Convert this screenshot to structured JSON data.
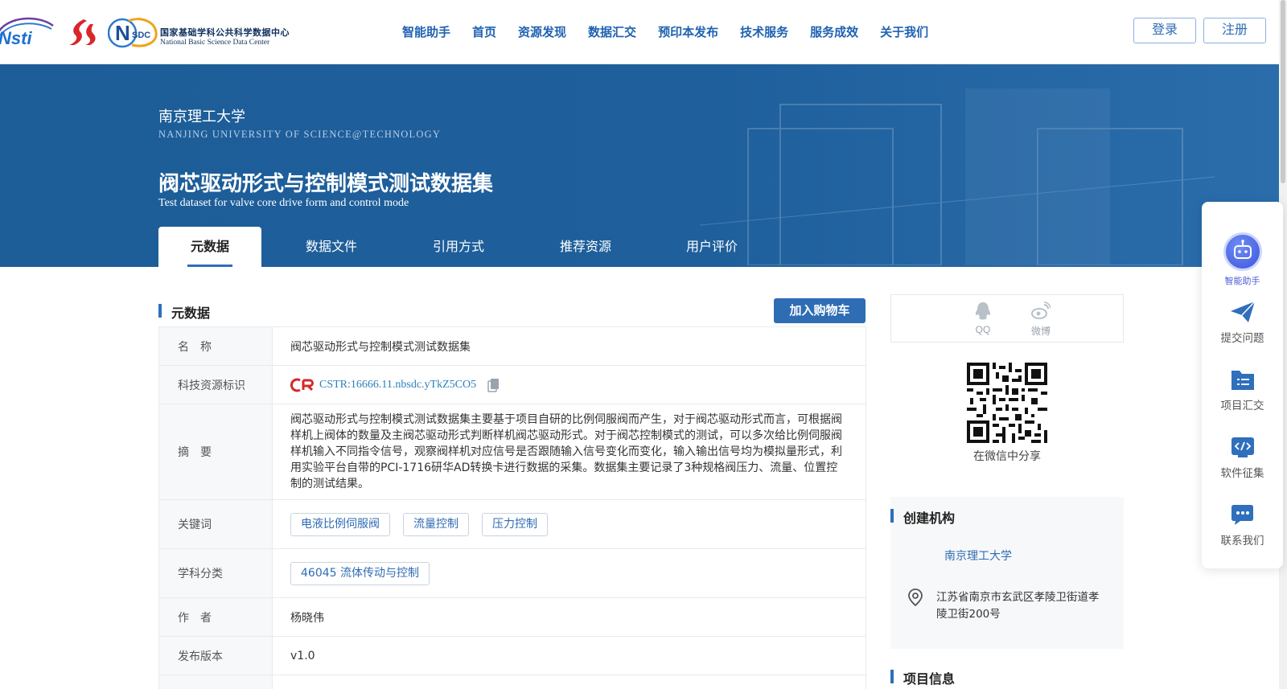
{
  "header": {
    "logo_nsti_text": "Nsti",
    "logo_nsdc_cn": "国家基础学科公共科学数据中心",
    "logo_nsdc_en": "National Basic Science Data Center",
    "logo_nsdc_badge": "SDC",
    "nav": [
      "智能助手",
      "首页",
      "资源发现",
      "数据汇交",
      "预印本发布",
      "技术服务",
      "服务成效",
      "关于我们"
    ],
    "login_label": "登录",
    "register_label": "注册"
  },
  "banner": {
    "university_cn": "南京理工大学",
    "university_en": "NANJING UNIVERSITY OF SCIENCE@TECHNOLOGY",
    "dataset_title": "阀芯驱动形式与控制模式测试数据集",
    "dataset_subtitle": "Test dataset for valve core drive form and control mode",
    "tabs": [
      "元数据",
      "数据文件",
      "引用方式",
      "推荐资源",
      "用户评价"
    ],
    "active_tab": "元数据"
  },
  "metadata": {
    "section_title": "元数据",
    "cart_button": "加入购物车",
    "rows": {
      "name": {
        "label": "名　称",
        "value": "阀芯驱动形式与控制模式测试数据集"
      },
      "identifier": {
        "label": "科技资源标识",
        "value": "CSTR:16666.11.nbsdc.yTkZ5CO5"
      },
      "abstract": {
        "label": "摘　要",
        "value": "阀芯驱动形式与控制模式测试数据集主要基于项目自研的比例伺服阀而产生，对于阀芯驱动形式而言，可根据阀样机上阀体的数量及主阀芯驱动形式判断样机阀芯驱动形式。对于阀芯控制模式的测试，可以多次给比例伺服阀样机输入不同指令信号，观察阀样机对应信号是否跟随输入信号变化而变化，输入输出信号均为模拟量形式，利用实验平台自带的PCI-1716研华AD转换卡进行数据的采集。数据集主要记录了3种规格阀压力、流量、位置控制的测试结果。"
      },
      "keywords": {
        "label": "关键词",
        "values": [
          "电液比例伺服阀",
          "流量控制",
          "压力控制"
        ]
      },
      "subject": {
        "label": "学科分类",
        "values": [
          "46045 流体传动与控制"
        ]
      },
      "author": {
        "label": "作　者",
        "value": "杨晓伟"
      },
      "version": {
        "label": "发布版本",
        "value": "v1.0"
      }
    }
  },
  "share": {
    "qq_label": "QQ",
    "weibo_label": "微博",
    "wechat_caption": "在微信中分享"
  },
  "organization": {
    "section_title": "创建机构",
    "name": "南京理工大学",
    "address": "江苏省南京市玄武区孝陵卫街道孝陵卫街200号"
  },
  "project": {
    "section_title": "项目信息"
  },
  "float_bar": {
    "assistant_label": "智能助手",
    "items": [
      "提交问题",
      "项目汇交",
      "软件征集",
      "联系我们"
    ]
  },
  "colors": {
    "primary": "#1f62b1",
    "banner": "#1d5d98",
    "accent_bar": "#2f6fbc",
    "cart_button": "#2e6db3"
  }
}
